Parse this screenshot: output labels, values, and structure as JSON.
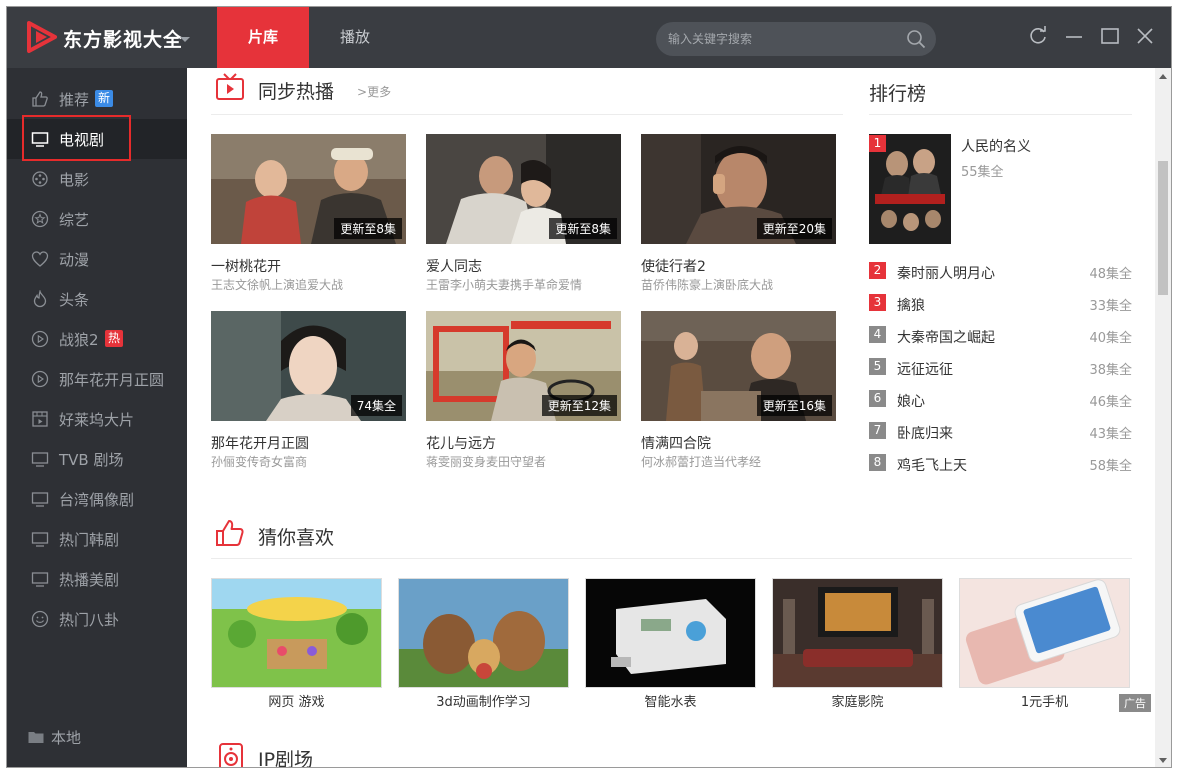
{
  "app": {
    "title": "东方影视大全"
  },
  "tabs": [
    {
      "label": "片库"
    },
    {
      "label": "播放"
    }
  ],
  "search": {
    "placeholder": "输入关键字搜索"
  },
  "sidebar": {
    "items": [
      {
        "label": "推荐",
        "badge": "新",
        "icon": "thumbs-up-icon"
      },
      {
        "label": "电视剧",
        "icon": "tv-icon"
      },
      {
        "label": "电影",
        "icon": "film-reel-icon"
      },
      {
        "label": "综艺",
        "icon": "star-icon"
      },
      {
        "label": "动漫",
        "icon": "heart-icon"
      },
      {
        "label": "头条",
        "icon": "fire-icon"
      },
      {
        "label": "战狼2",
        "badge": "热",
        "icon": "play-circle-icon"
      },
      {
        "label": "那年花开月正圆",
        "icon": "play-circle-icon"
      },
      {
        "label": "好莱坞大片",
        "icon": "film-frame-icon"
      },
      {
        "label": "TVB 剧场",
        "icon": "monitor-icon"
      },
      {
        "label": "台湾偶像剧",
        "icon": "monitor-icon"
      },
      {
        "label": "热门韩剧",
        "icon": "monitor-icon"
      },
      {
        "label": "热播美剧",
        "icon": "monitor-icon"
      },
      {
        "label": "热门八卦",
        "icon": "smiley-icon"
      }
    ],
    "local_label": "本地"
  },
  "sync": {
    "title": "同步热播",
    "more": "更多",
    "cards": [
      {
        "title": "一树桃花开",
        "subtitle": "王志文徐帆上演追爱大战",
        "badge": "更新至8集"
      },
      {
        "title": "爱人同志",
        "subtitle": "王雷李小萌夫妻携手革命爱情",
        "badge": "更新至8集"
      },
      {
        "title": "使徒行者2",
        "subtitle": "苗侨伟陈豪上演卧底大战",
        "badge": "更新至20集"
      },
      {
        "title": "那年花开月正圆",
        "subtitle": "孙俪变传奇女富商",
        "badge": "74集全"
      },
      {
        "title": "花儿与远方",
        "subtitle": "蒋雯丽变身麦田守望者",
        "badge": "更新至12集"
      },
      {
        "title": "情满四合院",
        "subtitle": "何冰郝蕾打造当代孝经",
        "badge": "更新至16集"
      }
    ]
  },
  "ranking": {
    "title": "排行榜",
    "items": [
      {
        "rank": "1",
        "title": "人民的名义",
        "count": "55集全"
      },
      {
        "rank": "2",
        "title": "秦时丽人明月心",
        "count": "48集全"
      },
      {
        "rank": "3",
        "title": "擒狼",
        "count": "33集全"
      },
      {
        "rank": "4",
        "title": "大秦帝国之崛起",
        "count": "40集全"
      },
      {
        "rank": "5",
        "title": "远征远征",
        "count": "38集全"
      },
      {
        "rank": "6",
        "title": "娘心",
        "count": "46集全"
      },
      {
        "rank": "7",
        "title": "卧底归来",
        "count": "43集全"
      },
      {
        "rank": "8",
        "title": "鸡毛飞上天",
        "count": "58集全"
      }
    ]
  },
  "guess": {
    "title": "猜你喜欢",
    "ads": [
      {
        "label": "网页 游戏"
      },
      {
        "label": "3d动画制作学习"
      },
      {
        "label": "智能水表"
      },
      {
        "label": "家庭影院"
      },
      {
        "label": "1元手机"
      }
    ],
    "ad_tag": "广告"
  },
  "ip": {
    "title": "IP剧场"
  },
  "colors": {
    "accent": "#e6333a",
    "sidebar_bg": "#2e3035",
    "titlebar_bg": "#3a3d42",
    "rank_grey": "#8a8a8a"
  }
}
